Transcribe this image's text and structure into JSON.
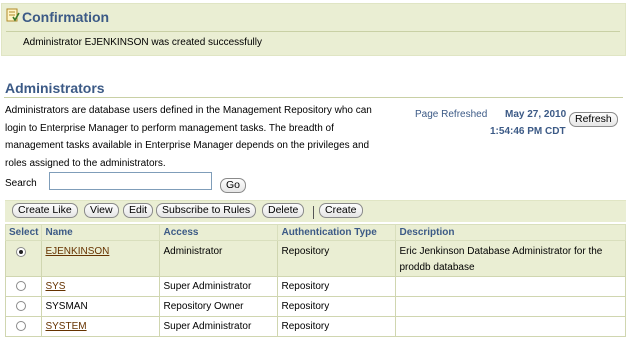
{
  "confirmation": {
    "title": "Confirmation",
    "message": "Administrator EJENKINSON was created successfully"
  },
  "section": {
    "title": "Administrators",
    "description": "Administrators are database users defined in the Management Repository who can login to Enterprise Manager to perform management tasks. The breadth of management tasks available in Enterprise Manager depends on the privileges and roles assigned to the administrators."
  },
  "refresh": {
    "label": "Page Refreshed",
    "date": "May 27, 2010",
    "time": "1:54:46 PM CDT",
    "button": "Refresh"
  },
  "search": {
    "label": "Search",
    "value": "",
    "go_button": "Go"
  },
  "toolbar": {
    "create_like": "Create Like",
    "view": "View",
    "edit": "Edit",
    "subscribe": "Subscribe to Rules",
    "delete": "Delete",
    "create": "Create"
  },
  "table": {
    "headers": {
      "select": "Select",
      "name": "Name",
      "access": "Access",
      "auth": "Authentication Type",
      "description": "Description"
    },
    "rows": [
      {
        "name": "EJENKINSON",
        "access": "Administrator",
        "auth": "Repository",
        "description": "Eric Jenkinson Database Administrator for the proddb database",
        "selected": true,
        "link": true
      },
      {
        "name": "SYS",
        "access": "Super Administrator",
        "auth": "Repository",
        "description": "",
        "selected": false,
        "link": true
      },
      {
        "name": "SYSMAN",
        "access": "Repository Owner",
        "auth": "Repository",
        "description": "",
        "selected": false,
        "link": false
      },
      {
        "name": "SYSTEM",
        "access": "Super Administrator",
        "auth": "Repository",
        "description": "",
        "selected": false,
        "link": true
      }
    ]
  },
  "colors": {
    "header_text": "#3c5a86",
    "panel_bg": "#eaeed3",
    "link": "#663300"
  }
}
